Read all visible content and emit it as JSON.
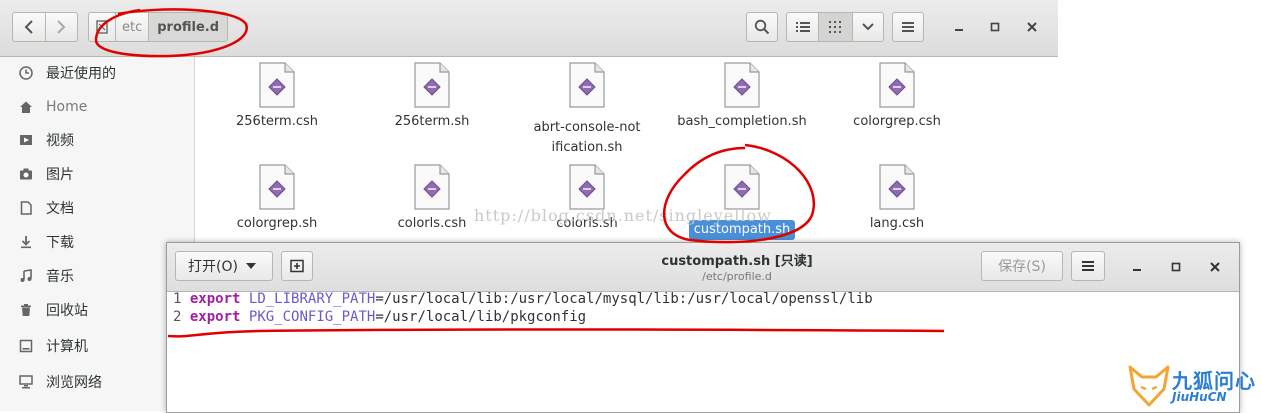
{
  "file_manager": {
    "path": [
      "etc",
      "profile.d"
    ],
    "sidebar": [
      {
        "label": "最近使用的",
        "icon": "clock-icon"
      },
      {
        "label": "Home",
        "icon": "home-icon"
      },
      {
        "label": "视频",
        "icon": "video-icon"
      },
      {
        "label": "图片",
        "icon": "camera-icon"
      },
      {
        "label": "文档",
        "icon": "document-icon"
      },
      {
        "label": "下载",
        "icon": "download-icon"
      },
      {
        "label": "音乐",
        "icon": "music-icon"
      },
      {
        "label": "回收站",
        "icon": "trash-icon"
      },
      {
        "label": "计算机",
        "icon": "computer-icon"
      },
      {
        "label": "浏览网络",
        "icon": "network-icon"
      }
    ],
    "files": [
      {
        "name": "256term.csh"
      },
      {
        "name": "256term.sh"
      },
      {
        "name": "abrt-console-notification.sh"
      },
      {
        "name": "bash_completion.sh"
      },
      {
        "name": "colorgrep.csh"
      },
      {
        "name": "colorgrep.sh"
      },
      {
        "name": "colorls.csh"
      },
      {
        "name": "colorls.sh"
      },
      {
        "name": "custompath.sh",
        "selected": true
      },
      {
        "name": "lang.csh"
      }
    ],
    "watermark": "http://blog.csdn.net/singleyellow"
  },
  "editor": {
    "open_label": "打开(O)",
    "title": "custompath.sh [只读]",
    "subtitle": "/etc/profile.d",
    "save_label": "保存(S)",
    "lines": [
      {
        "num": "1",
        "keyword": "export",
        "var": "LD_LIBRARY_PATH",
        "value": "=/usr/local/lib:/usr/local/mysql/lib:/usr/local/openssl/lib"
      },
      {
        "num": "2",
        "keyword": "export",
        "var": "PKG_CONFIG_PATH",
        "value": "=/usr/local/lib/pkgconfig"
      }
    ]
  },
  "logo": {
    "cn": "九狐问心",
    "en": "JiuHuCN"
  },
  "colors": {
    "selection": "#4a90d9",
    "annotation": "#e00000",
    "keyword": "#a020a0"
  }
}
